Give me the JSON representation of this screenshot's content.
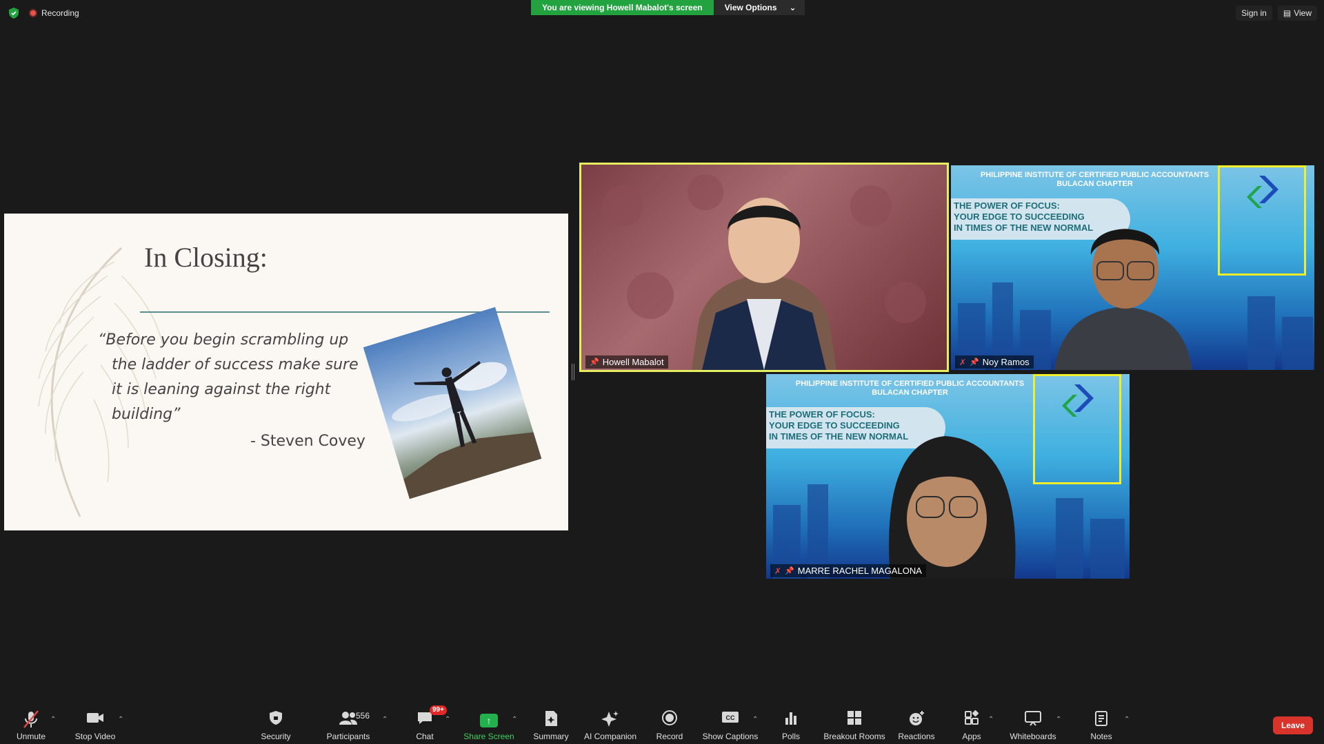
{
  "top": {
    "recording_label": "Recording",
    "viewing_message": "You are viewing Howell Mabalot's screen",
    "view_options_label": "View Options",
    "sign_in_label": "Sign in",
    "view_label": "View"
  },
  "slide": {
    "title": "In Closing:",
    "quote_lines": [
      "“Before you begin scrambling up",
      "the ladder of success make sure",
      "it is leaning against the right",
      "building”"
    ],
    "author": "- Steven Covey"
  },
  "banner": {
    "org_line1": "PHILIPPINE INSTITUTE OF CERTIFIED PUBLIC ACCOUNTANTS",
    "org_line2": "BULACAN CHAPTER",
    "topic_line1": "THE POWER OF FOCUS:",
    "topic_line2": "YOUR EDGE TO SUCCEEDING",
    "topic_line3": "IN TIMES OF THE NEW NORMAL"
  },
  "participants": [
    {
      "name": "Howell Mabalot"
    },
    {
      "name": "Noy Ramos"
    },
    {
      "name": "MARRE RACHEL MAGALONA"
    }
  ],
  "toolbar": {
    "unmute": "Unmute",
    "stop_video": "Stop Video",
    "security": "Security",
    "participants": "Participants",
    "participants_count": "556",
    "chat": "Chat",
    "chat_badge": "99+",
    "share_screen": "Share Screen",
    "summary": "Summary",
    "ai_companion": "AI Companion",
    "record": "Record",
    "show_captions": "Show Captions",
    "polls": "Polls",
    "breakout_rooms": "Breakout Rooms",
    "reactions": "Reactions",
    "apps": "Apps",
    "whiteboards": "Whiteboards",
    "notes": "Notes",
    "leave": "Leave"
  },
  "colors": {
    "share_green": "#22a340",
    "active_speaker_border": "#e6ef5f",
    "leave_red": "#d8342c"
  }
}
